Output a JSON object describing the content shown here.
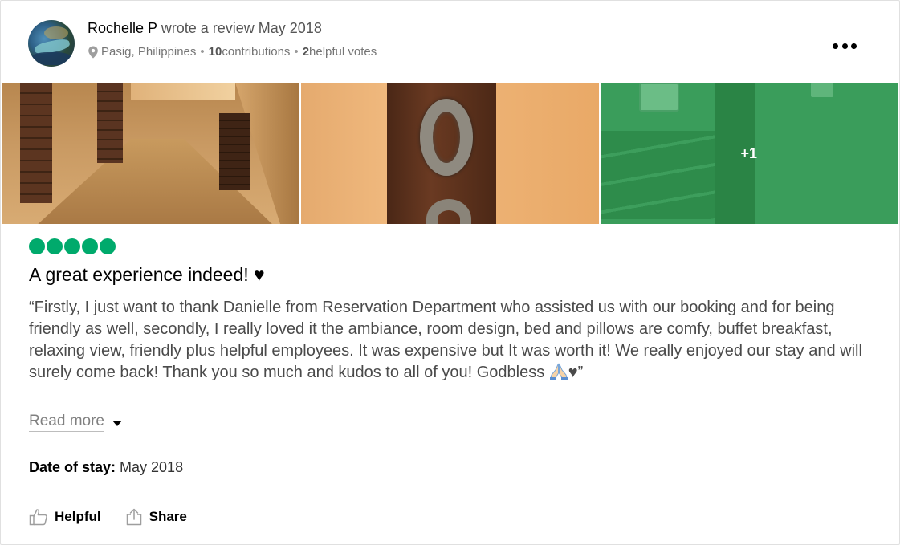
{
  "review": {
    "user": "Rochelle P",
    "action_text": " wrote a review May 2018",
    "location": "Pasig, Philippines",
    "contributions_count": "10",
    "contributions_label": " contributions",
    "helpful_votes_count": "2",
    "helpful_votes_label": " helpful votes",
    "separator": "•",
    "rating": 5,
    "title": "A great experience indeed! ♥",
    "body": "“Firstly, I just want to thank Danielle from Reservation Department who assisted us with our booking and for being friendly as well, secondly, I really loved it the ambiance, room design, bed and pillows are comfy, buffet breakfast, relaxing view, friendly plus helpful employees. It was expensive but It was worth it! We really enjoyed our stay and will surely come back! Thank you so much and kudos to all of you! Godbless ",
    "body_end": "♥”",
    "read_more": "Read more",
    "date_of_stay_label": "Date of stay:",
    "date_of_stay_value": " May 2018"
  },
  "photos": {
    "more_count": "+1"
  },
  "actions": {
    "helpful": "Helpful",
    "share": "Share"
  },
  "colors": {
    "rating_bubble": "#00aa6c",
    "photo_overlay": "#3a9d5b"
  },
  "icons": {
    "location": "map-pin-icon",
    "more": "more-options-icon",
    "helpful": "thumbs-up-icon",
    "share": "share-icon",
    "emoji": "folded-hands-emoji"
  }
}
